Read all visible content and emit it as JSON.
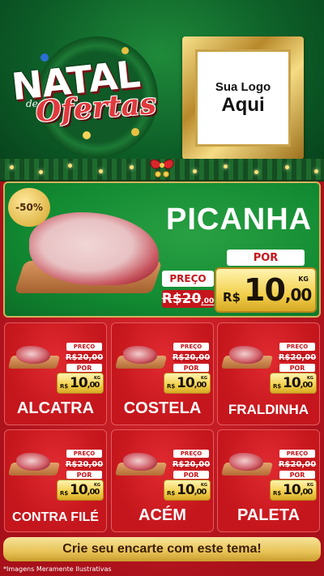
{
  "header": {
    "brand_line1": "NATAL",
    "brand_connector": "de",
    "brand_line2": "Ofertas",
    "logo_placeholder_line1": "Sua Logo",
    "logo_placeholder_line2": "Aqui"
  },
  "featured": {
    "name": "PICANHA",
    "discount_badge": "-50%",
    "old_label": "PREÇO",
    "old_price_main": "R$20",
    "old_price_cents": ",00",
    "new_label": "POR",
    "currency": "R$",
    "new_price_main": "10",
    "new_price_cents": ",00",
    "unit": "KG"
  },
  "products": [
    {
      "name": "ALCATRA",
      "old_label": "PREÇO",
      "old_price": "R$20,00",
      "new_label": "POR",
      "currency": "R$",
      "price_main": "10",
      "price_cents": ",00",
      "unit": "KG"
    },
    {
      "name": "COSTELA",
      "old_label": "PREÇO",
      "old_price": "R$20,00",
      "new_label": "POR",
      "currency": "R$",
      "price_main": "10",
      "price_cents": ",00",
      "unit": "KG"
    },
    {
      "name": "FRALDINHA",
      "old_label": "PREÇO",
      "old_price": "R$20,00",
      "new_label": "POR",
      "currency": "R$",
      "price_main": "10",
      "price_cents": ",00",
      "unit": "KG"
    },
    {
      "name": "CONTRA FILÉ",
      "old_label": "PREÇO",
      "old_price": "R$20,00",
      "new_label": "POR",
      "currency": "R$",
      "price_main": "10",
      "price_cents": ",00",
      "unit": "KG"
    },
    {
      "name": "ACÉM",
      "old_label": "PREÇO",
      "old_price": "R$20,00",
      "new_label": "POR",
      "currency": "R$",
      "price_main": "10",
      "price_cents": ",00",
      "unit": "KG"
    },
    {
      "name": "PALETA",
      "old_label": "PREÇO",
      "old_price": "R$20,00",
      "new_label": "POR",
      "currency": "R$",
      "price_main": "10",
      "price_cents": ",00",
      "unit": "KG"
    }
  ],
  "cta": {
    "label": "Crie seu encarte com este tema!"
  },
  "footnote": "*Imagens Meramente Ilustrativas",
  "colors": {
    "brand_red": "#c4161c",
    "brand_green": "#128a32",
    "gold": "#f2d04d"
  }
}
